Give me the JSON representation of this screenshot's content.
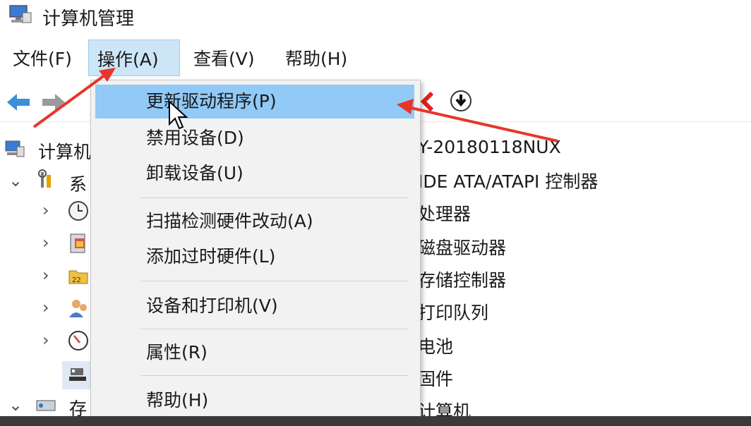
{
  "window": {
    "title": "计算机管理"
  },
  "menubar": {
    "items": [
      {
        "label": "文件(F)"
      },
      {
        "label": "操作(A)"
      },
      {
        "label": "查看(V)"
      },
      {
        "label": "帮助(H)"
      }
    ]
  },
  "dropdown": {
    "items": [
      {
        "label": "更新驱动程序(P)"
      },
      {
        "label": "禁用设备(D)"
      },
      {
        "label": "卸载设备(U)"
      },
      {
        "label": "扫描检测硬件改动(A)"
      },
      {
        "label": "添加过时硬件(L)"
      },
      {
        "label": "设备和打印机(V)"
      },
      {
        "label": "属性(R)"
      },
      {
        "label": "帮助(H)"
      }
    ]
  },
  "tree": {
    "root_label": "计算机",
    "system_label": "系",
    "storage_label": "存"
  },
  "device_header": "Y-20180118NUX",
  "device_list": [
    "IDE ATA/ATAPI 控制器",
    "处理器",
    "磁盘驱动器",
    "存储控制器",
    "打印队列",
    "电池",
    "固件",
    "计算机"
  ],
  "colors": {
    "highlight": "#91c9f7",
    "menu_active": "#cde6f7",
    "annotation_arrow": "#e8352a"
  }
}
